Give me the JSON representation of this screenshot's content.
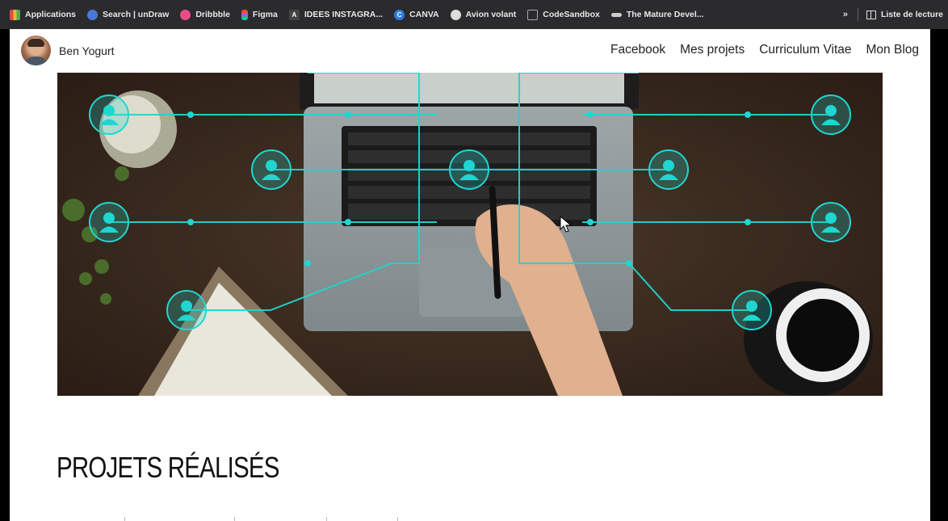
{
  "bookmarks": [
    {
      "label": "Applications",
      "icon": "apps-grid-icon",
      "color": "#e24a4a"
    },
    {
      "label": "Search | unDraw",
      "icon": "undraw-icon",
      "color": "#4a78d8"
    },
    {
      "label": "Dribbble",
      "icon": "dribbble-icon",
      "color": "#ea4c89"
    },
    {
      "label": "Figma",
      "icon": "figma-icon",
      "color": "#f24e1e"
    },
    {
      "label": "IDEES INSTAGRA...",
      "icon": "a-letter-icon",
      "color": "#444444"
    },
    {
      "label": "CANVA",
      "icon": "canva-icon",
      "color": "#2b7de9"
    },
    {
      "label": "Avion volant",
      "icon": "globe-icon",
      "color": "#dddddd"
    },
    {
      "label": "CodeSandbox",
      "icon": "codesandbox-icon",
      "color": "#888888"
    },
    {
      "label": "The Mature Devel...",
      "icon": "mustache-icon",
      "color": "#cccccc"
    }
  ],
  "bookmarks_more": "»",
  "reading_list": "Liste de lecture",
  "site": {
    "name": "Ben Yogurt",
    "menu": [
      "Facebook",
      "Mes projets",
      "Curriculum Vitae",
      "Mon Blog"
    ]
  },
  "section_title": "PROJETS RÉALISÉS",
  "colors": {
    "accent": "#1fd6d0",
    "hero_bg": "#3a2a20",
    "bookmark_bar": "#2b2b2d"
  }
}
